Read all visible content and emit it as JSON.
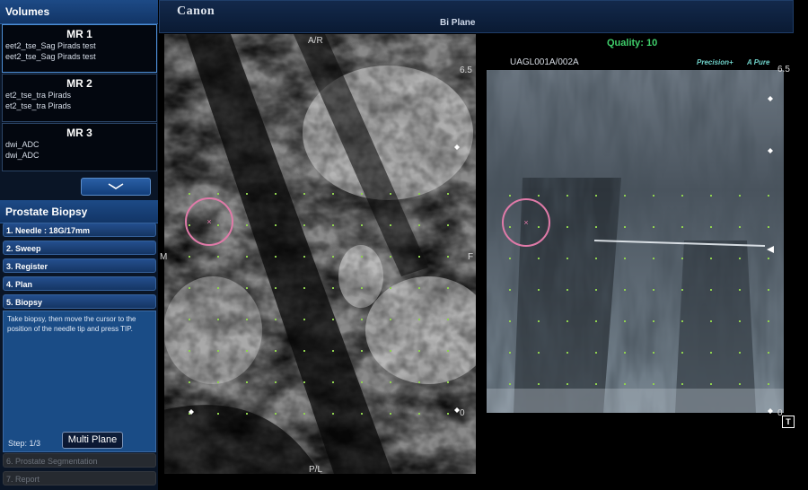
{
  "left_panel": {
    "volumes_title": "Volumes",
    "volumes": [
      {
        "title": "MR 1",
        "lines": [
          "eet2_tse_Sag Pirads test",
          "eet2_tse_Sag Pirads test"
        ]
      },
      {
        "title": "MR 2",
        "lines": [
          "et2_tse_tra Pirads",
          "et2_tse_tra Pirads"
        ]
      },
      {
        "title": "MR 3",
        "lines": [
          "dwi_ADC",
          "dwi_ADC"
        ]
      }
    ],
    "biopsy_title": "Prostate Biopsy",
    "steps": [
      {
        "label": "1. Needle : 18G/17mm"
      },
      {
        "label": "2. Sweep"
      },
      {
        "label": "3. Register"
      },
      {
        "label": "4. Plan"
      },
      {
        "label": "5. Biopsy"
      }
    ],
    "instruction": "Take biopsy, then move the cursor to the position of the needle tip and press TIP.",
    "step_counter": "Step:  1/3",
    "multi_plane_label": "Multi Plane",
    "disabled_steps": [
      "6. Prostate Segmentation",
      "7. Report"
    ]
  },
  "header": {
    "logo": "Canon",
    "title": "Bi Plane"
  },
  "mr_view": {
    "top_label": "A/R",
    "bottom_label": "P/L",
    "left_label": "M",
    "right_label": "F",
    "scale_top": "6.5",
    "scale_bottom": "0"
  },
  "us_view": {
    "quality": "Quality: 10",
    "probe_id": "UAGL001A/002A",
    "precision": "Precision+",
    "apure": "A Pure",
    "scale_top": "6.5",
    "scale_bottom": "0",
    "tip_marker": "T"
  },
  "colors": {
    "grid_dot": "#8fd14f",
    "target_circle": "#e07aa8",
    "quality_text": "#3fcf6b"
  }
}
